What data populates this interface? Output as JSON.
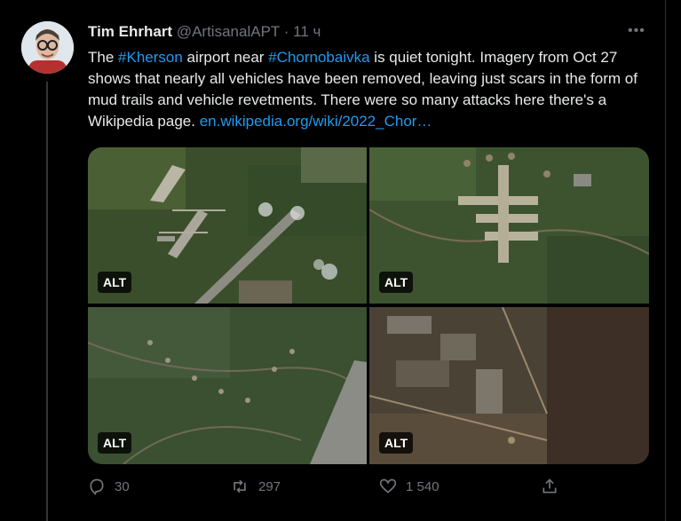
{
  "tweet": {
    "author_name": "Tim Ehrhart",
    "author_handle": "@ArtisanalAPT",
    "separator": "·",
    "time": "11 ч",
    "more_label": "•••",
    "text": {
      "p1": "The ",
      "hashtag1": "#Kherson",
      "p2": " airport near ",
      "hashtag2": "#Chornobaivka",
      "p3": " is quiet tonight. Imagery from Oct 27 shows that nearly all vehicles have been removed, leaving just scars in the form of mud trails and vehicle revetments. There were so many attacks here there's a Wikipedia page. ",
      "link": "en.wikipedia.org/wiki/2022_Chor…"
    }
  },
  "media": {
    "alt_badges": [
      "ALT",
      "ALT",
      "ALT",
      "ALT"
    ]
  },
  "actions": {
    "replies": "30",
    "retweets": "297",
    "likes": "1 540"
  },
  "colors": {
    "background": "#000000",
    "text": "#e7e9ea",
    "muted": "#71767b",
    "link": "#1d9bf0"
  }
}
